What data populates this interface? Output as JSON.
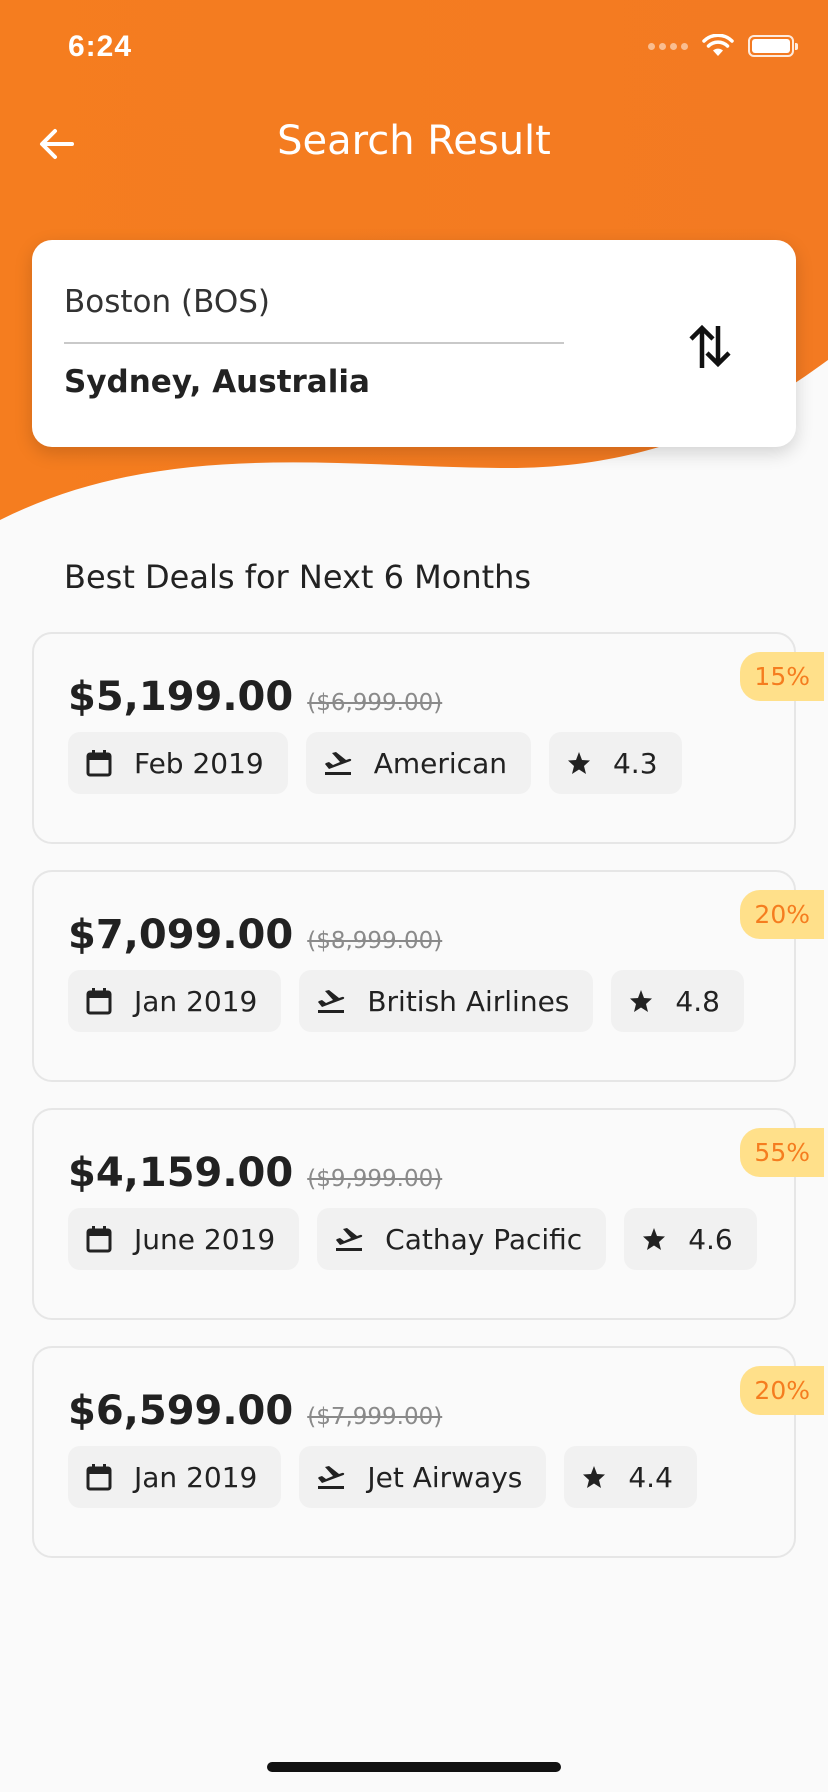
{
  "status_bar": {
    "time": "6:24"
  },
  "header": {
    "title": "Search Result",
    "back_icon": "arrow-left-icon",
    "color": "#F57D1F"
  },
  "route": {
    "from": "Boston (BOS)",
    "to": "Sydney, Australia",
    "swap_icon": "swap-vertical-icon"
  },
  "section_title": "Best Deals for Next 6 Months",
  "deals": [
    {
      "price": "$5,199.00",
      "old_price": "($6,999.00)",
      "discount": "15%",
      "date": "Feb 2019",
      "airline": "American",
      "rating": "4.3"
    },
    {
      "price": "$7,099.00",
      "old_price": "($8,999.00)",
      "discount": "20%",
      "date": "Jan 2019",
      "airline": "British Airlines",
      "rating": "4.8"
    },
    {
      "price": "$4,159.00",
      "old_price": "($9,999.00)",
      "discount": "55%",
      "date": "June 2019",
      "airline": "Cathay Pacific",
      "rating": "4.6"
    },
    {
      "price": "$6,599.00",
      "old_price": "($7,999.00)",
      "discount": "20%",
      "date": "Jan 2019",
      "airline": "Jet Airways",
      "rating": "4.4"
    }
  ],
  "colors": {
    "accent": "#F57D1F",
    "badge_bg": "#FFE08A",
    "badge_text": "#F57D1F"
  }
}
